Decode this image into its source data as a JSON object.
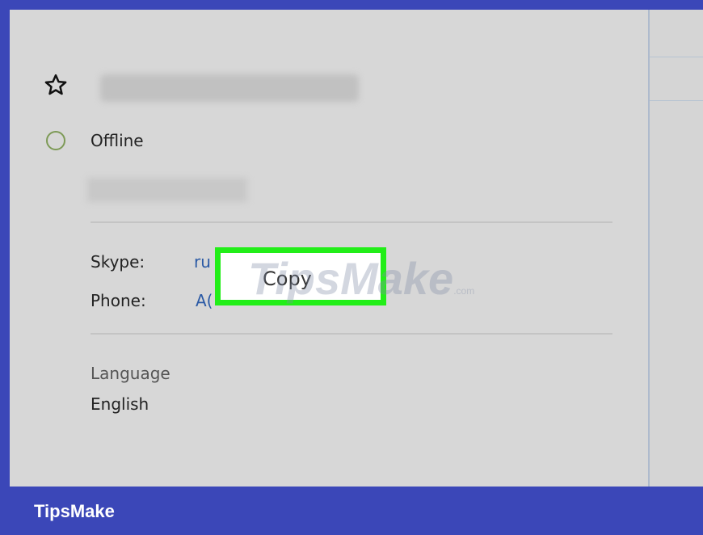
{
  "contact": {
    "status": "Offline",
    "fields": [
      {
        "label": "Skype:",
        "value": "ru"
      },
      {
        "label": "Phone:",
        "value": "A("
      }
    ],
    "language_label": "Language",
    "language_value": "English"
  },
  "context_menu": {
    "copy_label": "Copy"
  },
  "watermark": {
    "text": "TipsMake",
    "suffix": ".com"
  },
  "footer": {
    "brand": "TipsMake"
  },
  "colors": {
    "highlight": "#22ee18",
    "footer": "#3b47b8",
    "link": "#2b5aa5"
  },
  "icons": {
    "favorite": "star-outline-icon",
    "presence": "status-ring-icon"
  }
}
